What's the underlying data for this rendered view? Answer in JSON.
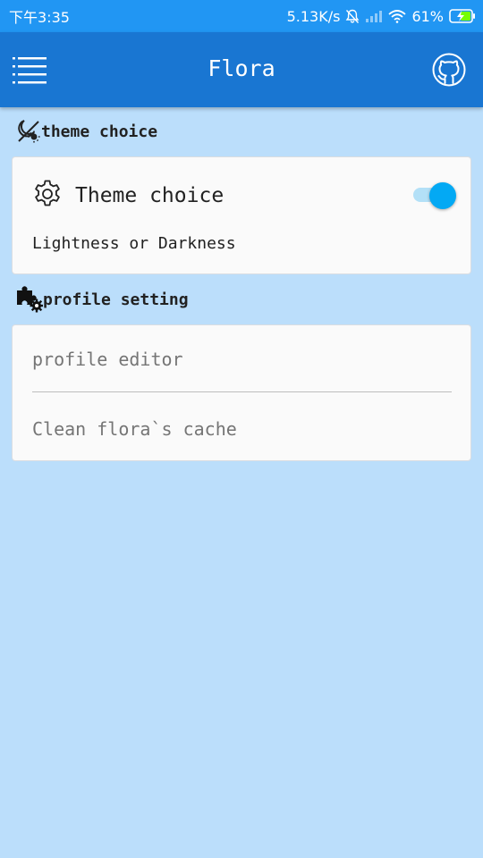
{
  "status_bar": {
    "time": "下午3:35",
    "network_speed": "5.13K/s",
    "battery": "61%"
  },
  "app_bar": {
    "title": "Flora",
    "menu_icon": "menu-icon",
    "github_icon": "github-icon"
  },
  "sections": {
    "theme": {
      "header": "theme choice",
      "icon": "theme-icon",
      "card": {
        "title": "Theme choice",
        "icon": "gear-icon",
        "subtitle": "Lightness or Darkness",
        "toggle_on": true
      }
    },
    "profile": {
      "header": "profile setting",
      "icon": "puzzle-gear-icon",
      "items": [
        {
          "label": "profile editor"
        },
        {
          "label": "Clean flora`s cache"
        }
      ]
    }
  },
  "colors": {
    "status_bar": "#2196f3",
    "app_bar": "#1976d2",
    "background": "#bbdefb",
    "card": "#fafafa",
    "toggle_thumb": "#03a9f4",
    "toggle_track": "#b3e0f7"
  }
}
